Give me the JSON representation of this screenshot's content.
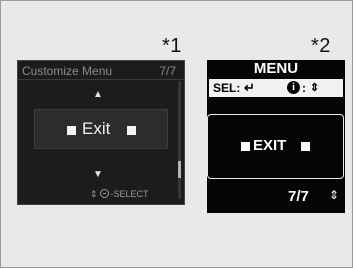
{
  "markers": {
    "first": "*1",
    "second": "*2"
  },
  "screen1": {
    "title": "Customize Menu",
    "page": "7/7",
    "up_arrow": "▲",
    "item_label": "Exit",
    "down_arrow": "▼",
    "hint_arrows": "⇕",
    "hint_text": "SELECT"
  },
  "screen2": {
    "header": "MENU",
    "sel_label": "SEL:",
    "return_glyph": "↵",
    "info_glyph": "i",
    "info_colon": ":",
    "updown_glyph": "⇕",
    "item_label": "EXIT",
    "page": "7/7",
    "page_arrows": "⇕"
  }
}
